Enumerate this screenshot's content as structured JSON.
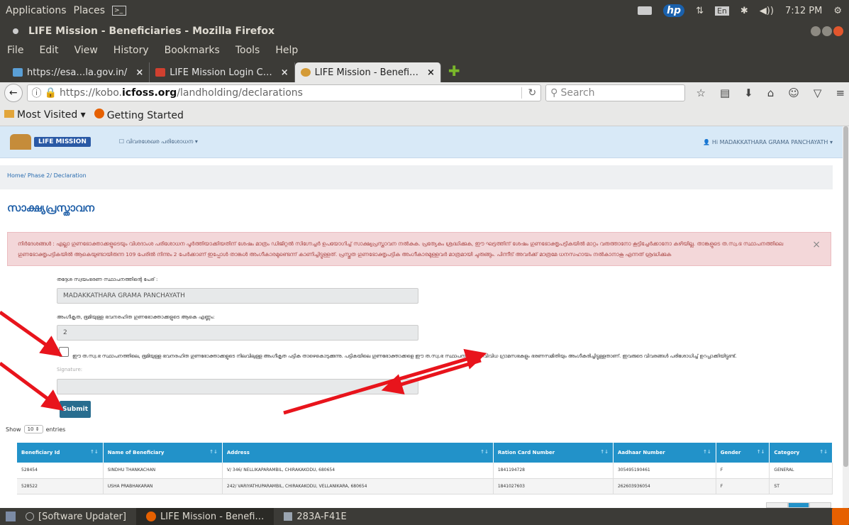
{
  "os": {
    "applications": "Applications",
    "places": "Places",
    "time": "7:12 PM",
    "lang": "En",
    "hp": "hp"
  },
  "window": {
    "title": "LIFE Mission - Beneficiaries - Mozilla Firefox"
  },
  "menu": [
    "File",
    "Edit",
    "View",
    "History",
    "Bookmarks",
    "Tools",
    "Help"
  ],
  "tabs": [
    {
      "label": "https://esa…la.gov.in/"
    },
    {
      "label": "LIFE Mission Login C…"
    },
    {
      "label": "LIFE Mission - Benefi…"
    }
  ],
  "nav": {
    "url_prefix": "https://kobo.",
    "url_domain": "icfoss.org",
    "url_path": "/landholding/declarations",
    "search_placeholder": "Search"
  },
  "bookmarks": [
    "Most Visited ▾",
    "Getting Started"
  ],
  "app": {
    "logo_text": "LIFE MISSION",
    "header_menu": "☐ വിവരശേഖര പരിശോധന ▾",
    "user": "Hi MADAKKATHARA GRAMA PANCHAYATH ▾",
    "breadcrumb": "Home/ Phase 2/ Declaration",
    "title": "സാക്ഷ്യപ്രസ്താവന",
    "alert_line1": "നിർദേശങ്ങൾ : എല്ലാ ഗുണഭോക്താക്കളുടെയും വിശദാംശ പരിശോധന പൂർത്തിയാക്കിയതിന് ശേഷം മാത്രം ഡിജിറ്റൽ സിഗ്നേച്ചർ ഉപയോഗിച്ച് സാക്ഷ്യപ്രസ്താവന നൽകുക. പ്രത്യേകം ശ്രദ്ധിക്കുക, ഈ ഘട്ടത്തിന് ശേഷം ഗുണഭോക്തൃപട്ടികയിൽ മാറ്റം വരുത്താനോ കൂട്ടിച്ചേർക്കാനോ കഴിയില്ല. താങ്കളുടെ ത.സ്വ.ഭ സ്ഥാപനത്തിലെ",
    "alert_line2": "ഗുണഭോക്തൃപട്ടികയിൽ ആകെയുണ്ടായിരുന്ന 109 പേരിൽ നിന്നും 2 പേർക്കാണ് ഇപ്പോൾ താങ്കൾ അംഗീകാരമുണ്ടെന്ന് കാണിച്ചിട്ടുള്ളത്. പ്രസ്തുത ഗുണഭോക്തൃപട്ടിക അംഗീകാരമുള്ളവർ മാത്രമായി ചുരുങ്ങും. പിന്നീട് അവർക്ക് മാത്രമേ ധനസഹായം നൽകാനാകൂ എന്നത് ശ്രദ്ധിക്കുക",
    "alert_close": "×",
    "lsg_label": "തദ്ദേശ സ്വയംഭരണ സ്ഥാപനത്തിന്റെ പേര് :",
    "lsg_value": "MADAKKATHARA GRAMA PANCHAYATH",
    "count_label": "അംഗീകൃത, ഭൂമിയുള്ള ഭവനരഹിത ഗുണഭോക്താക്കളുടെ ആകെ എണ്ണം:",
    "count_value": "2",
    "checkbox_text": "ഈ ത.സ്വ.ഭ സ്ഥാപനത്തിലെ, ഭൂമിയുള്ള ഭവനരഹിത ഗുണഭോക്താക്കളുടെ നിലവിലുള്ള അംഗീകൃത പട്ടിക താഴെകൊടുക്കുന്നു. പട്ടികയിലെ ഗുണഭോക്താക്കളെ ഈ ത.സ്വ.ഭ സ്ഥാപനത്തിലെ വിവിധ ഗ്രാമസഭകളും ഭരണസമിതിയും അംഗീകരിച്ചിട്ടുള്ളതാണ്. ഇവരുടെ വിവരങ്ങൾ പരിശോധിച്ച് ഉറപ്പാക്കിയിട്ടുണ്ട്.",
    "signature_placeholder": "Signature:",
    "submit": "Submit",
    "show": "Show",
    "entries_value": "10",
    "entries": "entries"
  },
  "table": {
    "columns": [
      "Beneficiary Id",
      "Name of Beneficiary",
      "Address",
      "Ration Card Number",
      "Aadhaar Number",
      "Gender",
      "Category"
    ],
    "rows": [
      [
        "528454",
        "SINDHU THANKACHAN",
        "V/ 346/ NELLIKAPARAMBIL, CHIRAKAKODU, 680654",
        "1841194728",
        "305495190461",
        "F",
        "GENERAL"
      ],
      [
        "528522",
        "USHA PRABHAKARAN",
        "242/ VARIYATHUPARAMBIL, CHIRAKAKODU, VELLANIKARA, 680654",
        "1841027603",
        "262603936054",
        "F",
        "ST"
      ]
    ]
  },
  "taskbar": [
    "[Software Updater]",
    "LIFE Mission - Benefi…",
    "283A-F41E"
  ],
  "colors": {
    "annotation_arrow": "#e8141c",
    "table_header": "#2292c9",
    "alert_bg": "#f3d7d9"
  }
}
